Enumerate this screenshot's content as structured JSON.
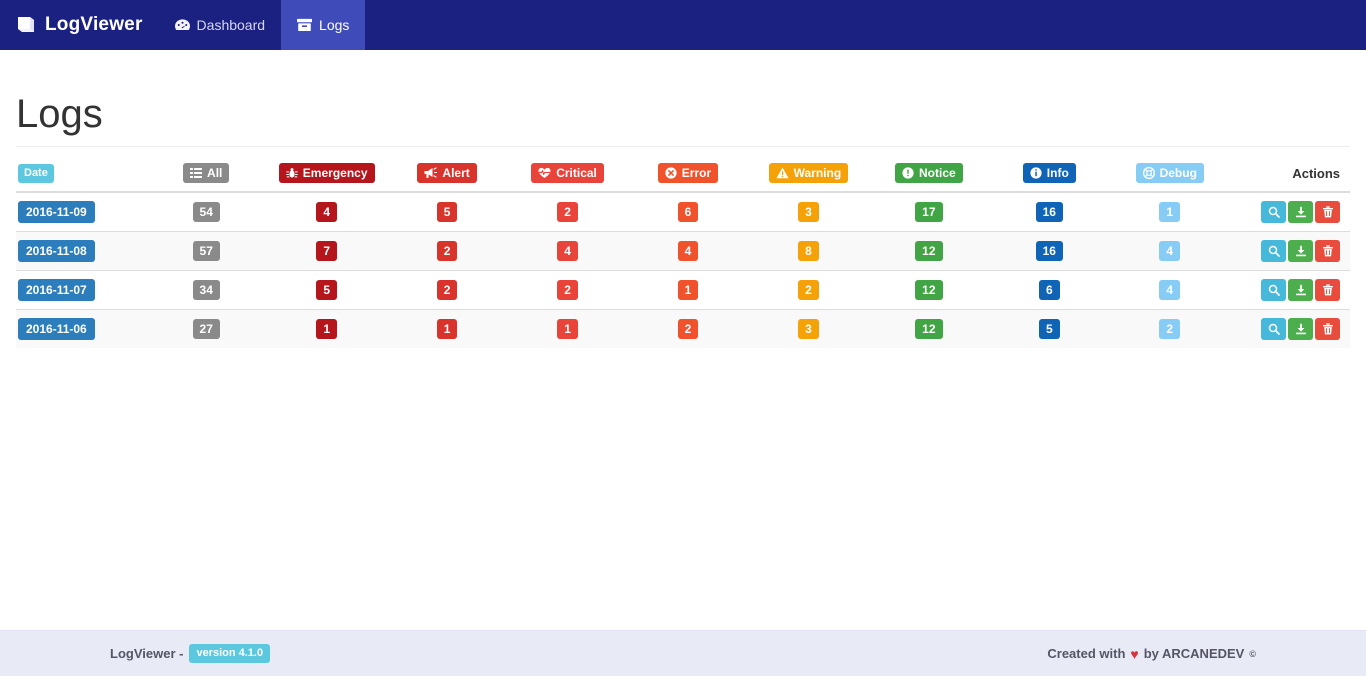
{
  "navbar": {
    "brand": "LogViewer",
    "brand_icon": "book-icon",
    "items": [
      {
        "label": "Dashboard",
        "icon": "dashboard-icon",
        "active": false
      },
      {
        "label": "Logs",
        "icon": "archive-icon",
        "active": true
      }
    ]
  },
  "page": {
    "title": "Logs"
  },
  "table": {
    "headers": {
      "date": {
        "label": "Date",
        "color": "#5bc8e0",
        "icon": ""
      },
      "actions": {
        "label": "Actions"
      },
      "levels": [
        {
          "key": "all",
          "label": "All",
          "icon": "list-icon",
          "color": "#8a8a8a"
        },
        {
          "key": "emergency",
          "label": "Emergency",
          "icon": "bug-icon",
          "color": "#b4161b"
        },
        {
          "key": "alert",
          "label": "Alert",
          "icon": "bullhorn-icon",
          "color": "#d9342b"
        },
        {
          "key": "critical",
          "label": "Critical",
          "icon": "heartbeat-icon",
          "color": "#e8443a"
        },
        {
          "key": "error",
          "label": "Error",
          "icon": "times-circle-icon",
          "color": "#f0522b"
        },
        {
          "key": "warning",
          "label": "Warning",
          "icon": "warning-triangle-icon",
          "color": "#f5a209"
        },
        {
          "key": "notice",
          "label": "Notice",
          "icon": "exclamation-circle-icon",
          "color": "#42a545"
        },
        {
          "key": "info",
          "label": "Info",
          "icon": "info-circle-icon",
          "color": "#1064b5"
        },
        {
          "key": "debug",
          "label": "Debug",
          "icon": "life-ring-icon",
          "color": "#87ccf5"
        }
      ]
    },
    "rows": [
      {
        "date": "2016-11-09",
        "all": 54,
        "emergency": 4,
        "alert": 5,
        "critical": 2,
        "error": 6,
        "warning": 3,
        "notice": 17,
        "info": 16,
        "debug": 1
      },
      {
        "date": "2016-11-08",
        "all": 57,
        "emergency": 7,
        "alert": 2,
        "critical": 4,
        "error": 4,
        "warning": 8,
        "notice": 12,
        "info": 16,
        "debug": 4
      },
      {
        "date": "2016-11-07",
        "all": 34,
        "emergency": 5,
        "alert": 2,
        "critical": 2,
        "error": 1,
        "warning": 2,
        "notice": 12,
        "info": 6,
        "debug": 4
      },
      {
        "date": "2016-11-06",
        "all": 27,
        "emergency": 1,
        "alert": 1,
        "critical": 1,
        "error": 2,
        "warning": 3,
        "notice": 12,
        "info": 5,
        "debug": 2
      }
    ],
    "row_actions": [
      {
        "key": "show",
        "icon": "search-icon",
        "title": "Show"
      },
      {
        "key": "download",
        "icon": "download-icon",
        "title": "Download"
      },
      {
        "key": "delete",
        "icon": "trash-icon",
        "title": "Delete"
      }
    ]
  },
  "footer": {
    "app_name": "LogViewer -",
    "version": "version 4.1.0",
    "credit_prefix": "Created with",
    "credit_heart": "♥",
    "credit_middle": "by ARCANEDEV",
    "credit_suffix": "©"
  }
}
